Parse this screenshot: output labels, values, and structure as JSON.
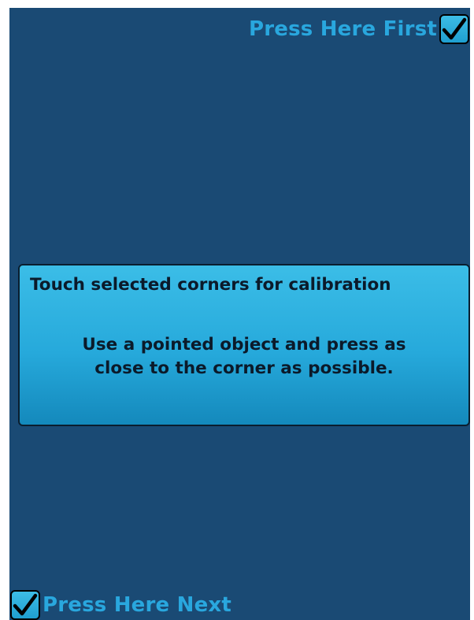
{
  "colors": {
    "screen_background": "#1a4a74",
    "corner_label": "#29a7de",
    "dialog_background": "#26a9db",
    "dialog_text": "#0b1a2a"
  },
  "targets": {
    "first": {
      "label": "Press Here First",
      "icon": "checkmark-icon"
    },
    "next": {
      "label": "Press Here Next",
      "icon": "checkmark-icon"
    }
  },
  "dialog": {
    "title": "Touch selected corners for calibration",
    "message_lines": [
      "Use a pointed object and press as",
      "close to the corner as possible."
    ]
  }
}
